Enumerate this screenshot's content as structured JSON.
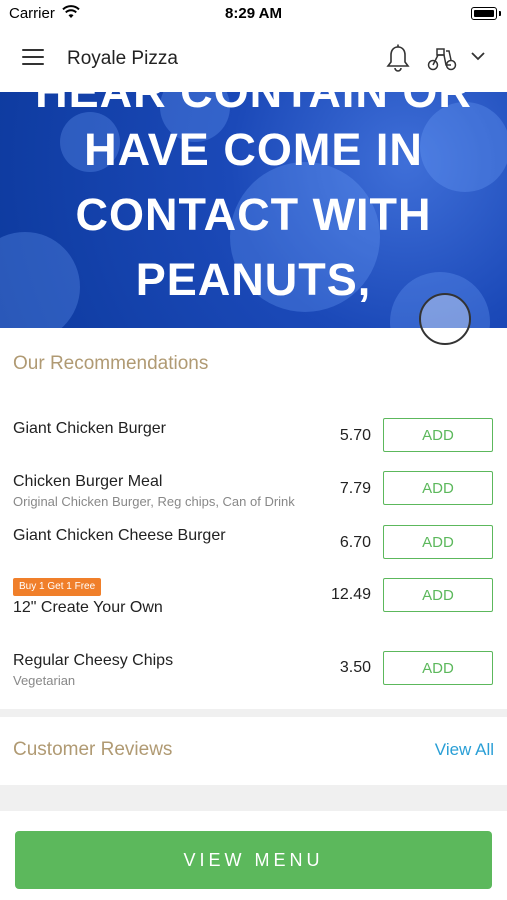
{
  "status_bar": {
    "carrier": "Carrier",
    "time": "8:29 AM"
  },
  "header": {
    "title": "Royale Pizza"
  },
  "banner": {
    "lines": [
      "HEAR CONTAIN OR",
      "HAVE COME IN",
      "CONTACT WITH",
      "PEANUTS,"
    ]
  },
  "recommendations": {
    "title": "Our Recommendations",
    "items": [
      {
        "name": "Giant Chicken Burger",
        "description": "",
        "price": "5.70",
        "add_label": "ADD"
      },
      {
        "name": "Chicken Burger Meal",
        "description": "Original Chicken Burger, Reg chips, Can of Drink",
        "price": "7.79",
        "add_label": "ADD"
      },
      {
        "name": "Giant Chicken Cheese Burger",
        "description": "",
        "price": "6.70",
        "add_label": "ADD"
      },
      {
        "name": "12\" Create Your Own",
        "description": "",
        "price": "12.49",
        "add_label": "ADD",
        "promo": "Buy 1 Get 1 Free"
      },
      {
        "name": "Regular Cheesy Chips",
        "description": "Vegetarian",
        "price": "3.50",
        "add_label": "ADD"
      }
    ]
  },
  "reviews": {
    "title": "Customer Reviews",
    "view_all": "View All"
  },
  "footer": {
    "view_menu": "VIEW MENU"
  },
  "colors": {
    "accent_green": "#5cb85c",
    "section_title": "#b09a73",
    "link_blue": "#2a9fd6",
    "promo_orange": "#f07f2a"
  }
}
